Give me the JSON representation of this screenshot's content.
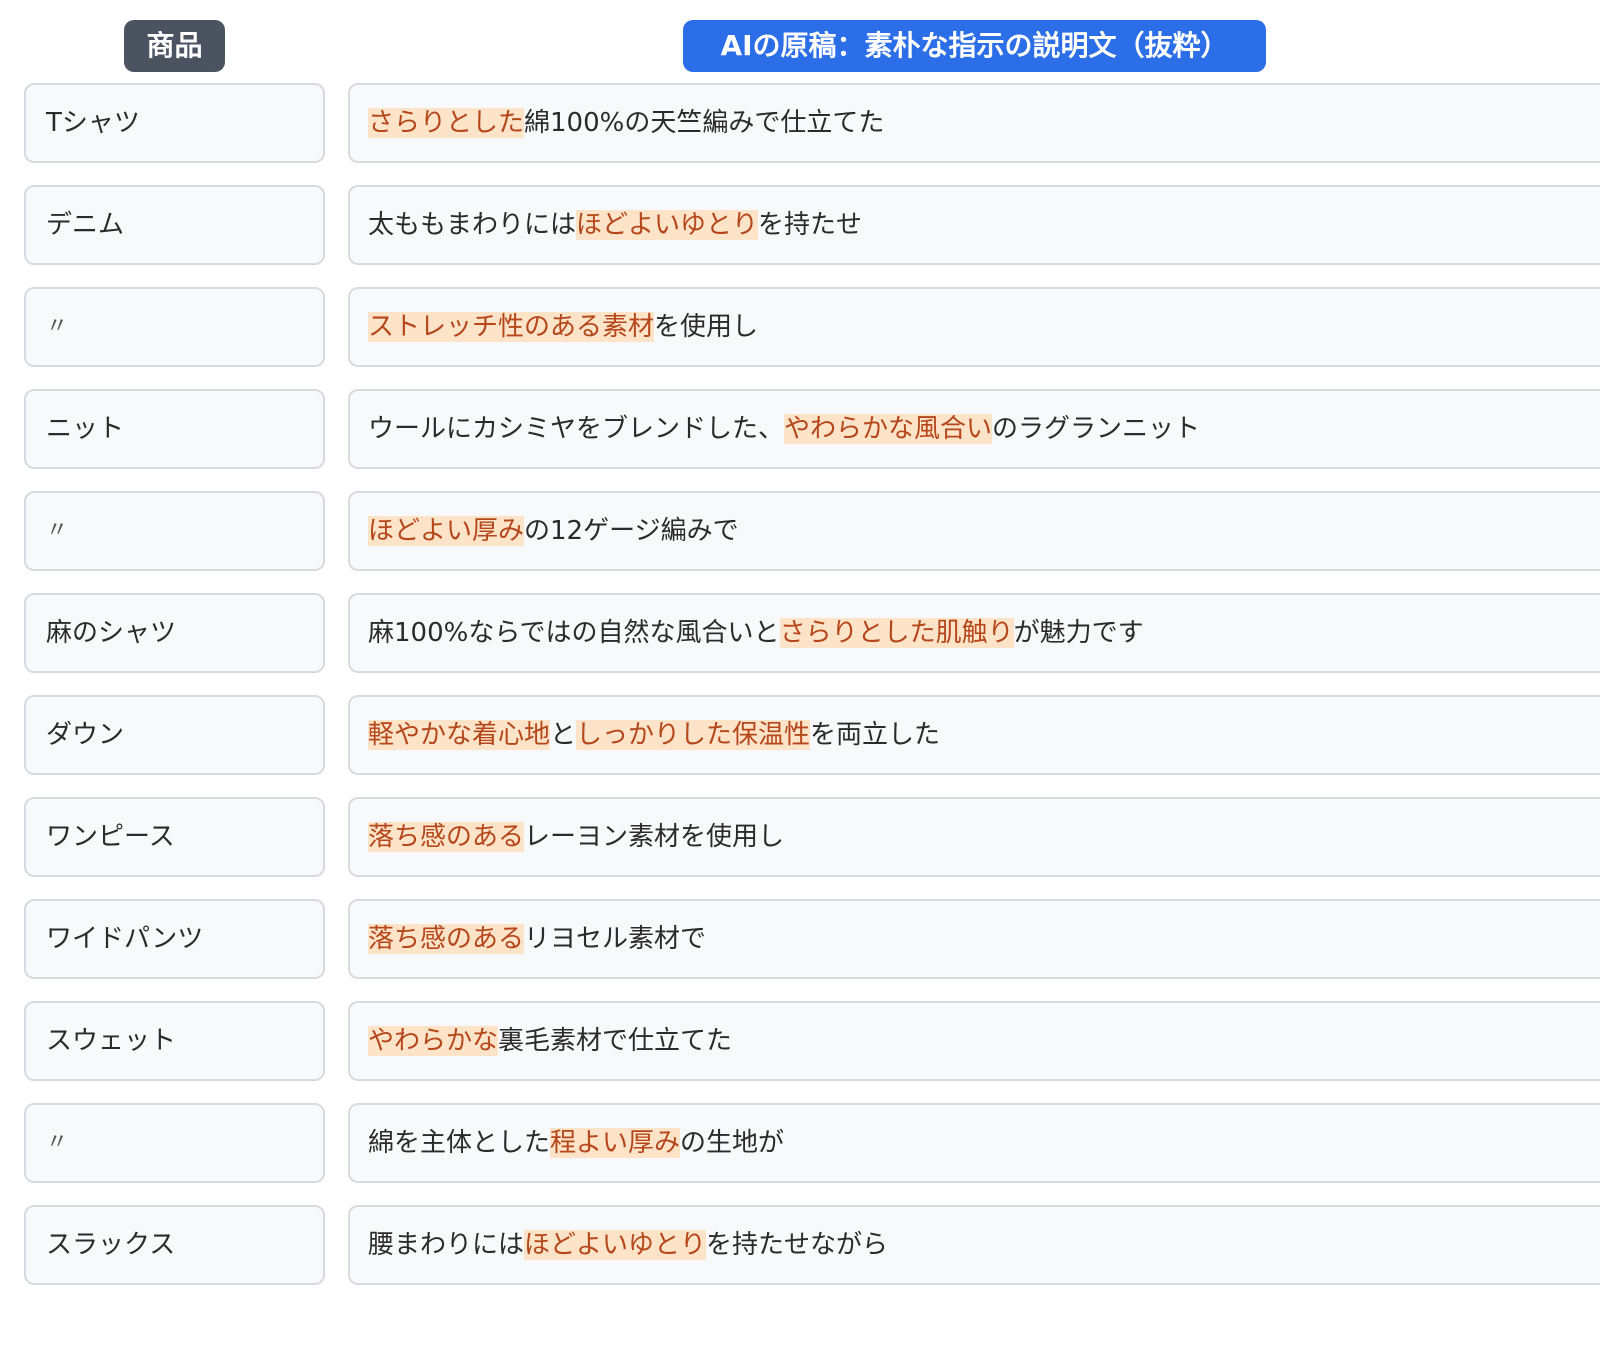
{
  "headers": {
    "product": "商品",
    "description": "AIの原稿：素朴な指示の説明文（抜粋）"
  },
  "rows": [
    {
      "product": "Tシャツ",
      "segments": [
        {
          "text": "さらりとした",
          "hl": true
        },
        {
          "text": "綿100%の天竺編みで仕立てた",
          "hl": false
        }
      ]
    },
    {
      "product": "デニム",
      "segments": [
        {
          "text": "太ももまわりには",
          "hl": false
        },
        {
          "text": "ほどよいゆとり",
          "hl": true
        },
        {
          "text": "を持たせ",
          "hl": false
        }
      ]
    },
    {
      "product": "〃",
      "segments": [
        {
          "text": "ストレッチ性のある素材",
          "hl": true
        },
        {
          "text": "を使用し",
          "hl": false
        }
      ]
    },
    {
      "product": "ニット",
      "segments": [
        {
          "text": "ウールにカシミヤをブレンドした、",
          "hl": false
        },
        {
          "text": "やわらかな風合い",
          "hl": true
        },
        {
          "text": "のラグランニット",
          "hl": false
        }
      ]
    },
    {
      "product": "〃",
      "segments": [
        {
          "text": "ほどよい厚み",
          "hl": true
        },
        {
          "text": "の12ゲージ編みで",
          "hl": false
        }
      ]
    },
    {
      "product": "麻のシャツ",
      "segments": [
        {
          "text": "麻100%ならではの自然な風合いと",
          "hl": false
        },
        {
          "text": "さらりとした肌触り",
          "hl": true
        },
        {
          "text": "が魅力です",
          "hl": false
        }
      ]
    },
    {
      "product": "ダウン",
      "segments": [
        {
          "text": "軽やかな着心地",
          "hl": true
        },
        {
          "text": "と",
          "hl": false
        },
        {
          "text": "しっかりした保温性",
          "hl": true
        },
        {
          "text": "を両立した",
          "hl": false
        }
      ]
    },
    {
      "product": "ワンピース",
      "segments": [
        {
          "text": "落ち感のある",
          "hl": true
        },
        {
          "text": "レーヨン素材を使用し",
          "hl": false
        }
      ]
    },
    {
      "product": "ワイドパンツ",
      "segments": [
        {
          "text": "落ち感のある",
          "hl": true
        },
        {
          "text": "リヨセル素材で",
          "hl": false
        }
      ]
    },
    {
      "product": "スウェット",
      "segments": [
        {
          "text": "やわらかな",
          "hl": true
        },
        {
          "text": "裏毛素材で仕立てた",
          "hl": false
        }
      ]
    },
    {
      "product": "〃",
      "segments": [
        {
          "text": "綿を主体とした",
          "hl": false
        },
        {
          "text": "程よい厚み",
          "hl": true
        },
        {
          "text": "の生地が",
          "hl": false
        }
      ]
    },
    {
      "product": "スラックス",
      "segments": [
        {
          "text": "腰まわりには",
          "hl": false
        },
        {
          "text": "ほどよいゆとり",
          "hl": true
        },
        {
          "text": "を持たせながら",
          "hl": false
        }
      ]
    }
  ]
}
